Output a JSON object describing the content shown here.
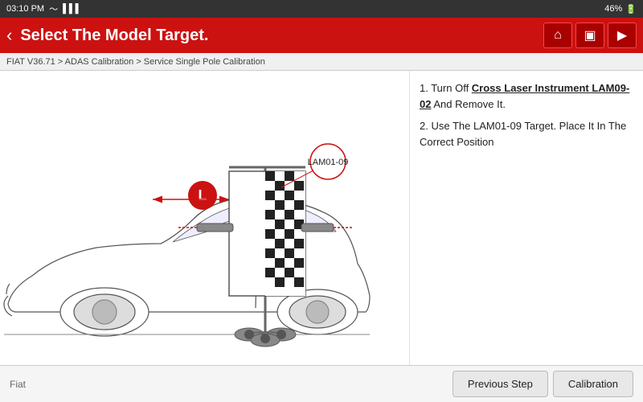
{
  "statusBar": {
    "time": "03:10 PM",
    "battery": "46%",
    "wifiSymbol": "📶"
  },
  "header": {
    "title": "Select The Model Target.",
    "backLabel": "‹",
    "icons": [
      "⌂",
      "▣",
      "▶"
    ]
  },
  "breadcrumb": {
    "text": "FIAT V36.71 > ADAS Calibration > Service Single Pole Calibration"
  },
  "instructions": {
    "line1_prefix": "1. Turn Off ",
    "line1_bold": "Cross Laser Instrument LAM09-02",
    "line1_suffix": " And Remove It.",
    "line2": "2. Use The LAM01-09 Target. Place It In The Correct Position"
  },
  "diagram": {
    "labelTag": "LAM01-09",
    "markerL": "L"
  },
  "bottomBar": {
    "brand": "Fiat",
    "buttons": [
      "Previous Step",
      "Calibration"
    ]
  }
}
